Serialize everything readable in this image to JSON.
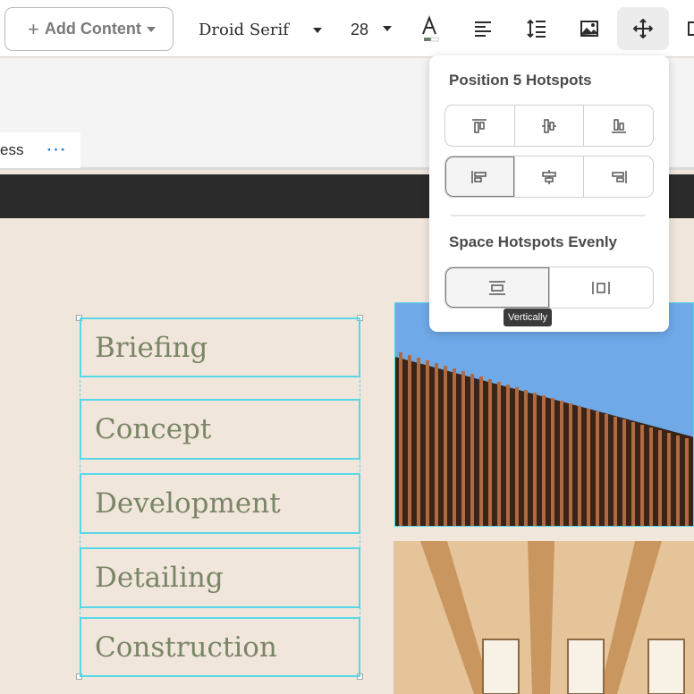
{
  "toolbar": {
    "add_content_label": "Add Content",
    "font_family_value": "Droid Serif",
    "font_size_value": "28"
  },
  "breadcrumb": {
    "text": "ess",
    "more": "···"
  },
  "hotspots": [
    {
      "label": "Briefing"
    },
    {
      "label": "Concept"
    },
    {
      "label": "Development"
    },
    {
      "label": "Detailing"
    },
    {
      "label": "Construction"
    }
  ],
  "panel": {
    "position_title": "Position 5 Hotspots",
    "space_title": "Space Hotspots Evenly",
    "tooltip": "Vertically"
  },
  "colors": {
    "hotspot_border": "#56d8e8",
    "hotspot_text": "#7a8566",
    "background": "#f0e6dc",
    "dark_band": "#2b2b2b"
  }
}
